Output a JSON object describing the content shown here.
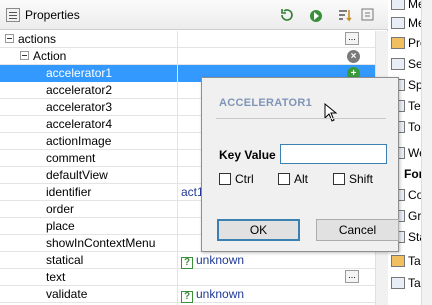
{
  "panel": {
    "title": "Properties"
  },
  "tree": {
    "root_label": "actions",
    "group_label": "Action",
    "rows": [
      {
        "name": "accelerator1",
        "value": ""
      },
      {
        "name": "accelerator2",
        "value": ""
      },
      {
        "name": "accelerator3",
        "value": ""
      },
      {
        "name": "accelerator4",
        "value": ""
      },
      {
        "name": "actionImage",
        "value": ""
      },
      {
        "name": "comment",
        "value": ""
      },
      {
        "name": "defaultView",
        "value": ""
      },
      {
        "name": "identifier",
        "value": "act1"
      },
      {
        "name": "order",
        "value": ""
      },
      {
        "name": "place",
        "value": ""
      },
      {
        "name": "showInContextMenu",
        "value": ""
      },
      {
        "name": "statical",
        "value": "unknown"
      },
      {
        "name": "text",
        "value": ""
      },
      {
        "name": "validate",
        "value": "unknown"
      }
    ],
    "unknown_glyph": "?",
    "ellipsis_glyph": "...",
    "remove_glyph": "×",
    "add_glyph": "+"
  },
  "palette": {
    "items": [
      "Men",
      "Men",
      "Prog",
      "Sepa",
      "Spin",
      "Text",
      "Tool",
      "Web",
      "Form",
      "Coo",
      "Grid",
      "Stac",
      "Tabl",
      "Tabl"
    ]
  },
  "dialog": {
    "title": "ACCELERATOR1",
    "key_value_label": "Key Value",
    "key_value": "",
    "checkboxes": [
      {
        "label": "Ctrl",
        "checked": false
      },
      {
        "label": "Alt",
        "checked": false
      },
      {
        "label": "Shift",
        "checked": false
      }
    ],
    "ok_label": "OK",
    "cancel_label": "Cancel"
  },
  "colors": {
    "selection": "#3399ff",
    "dialog_title": "#7f95b8",
    "link": "#1f3a93"
  }
}
